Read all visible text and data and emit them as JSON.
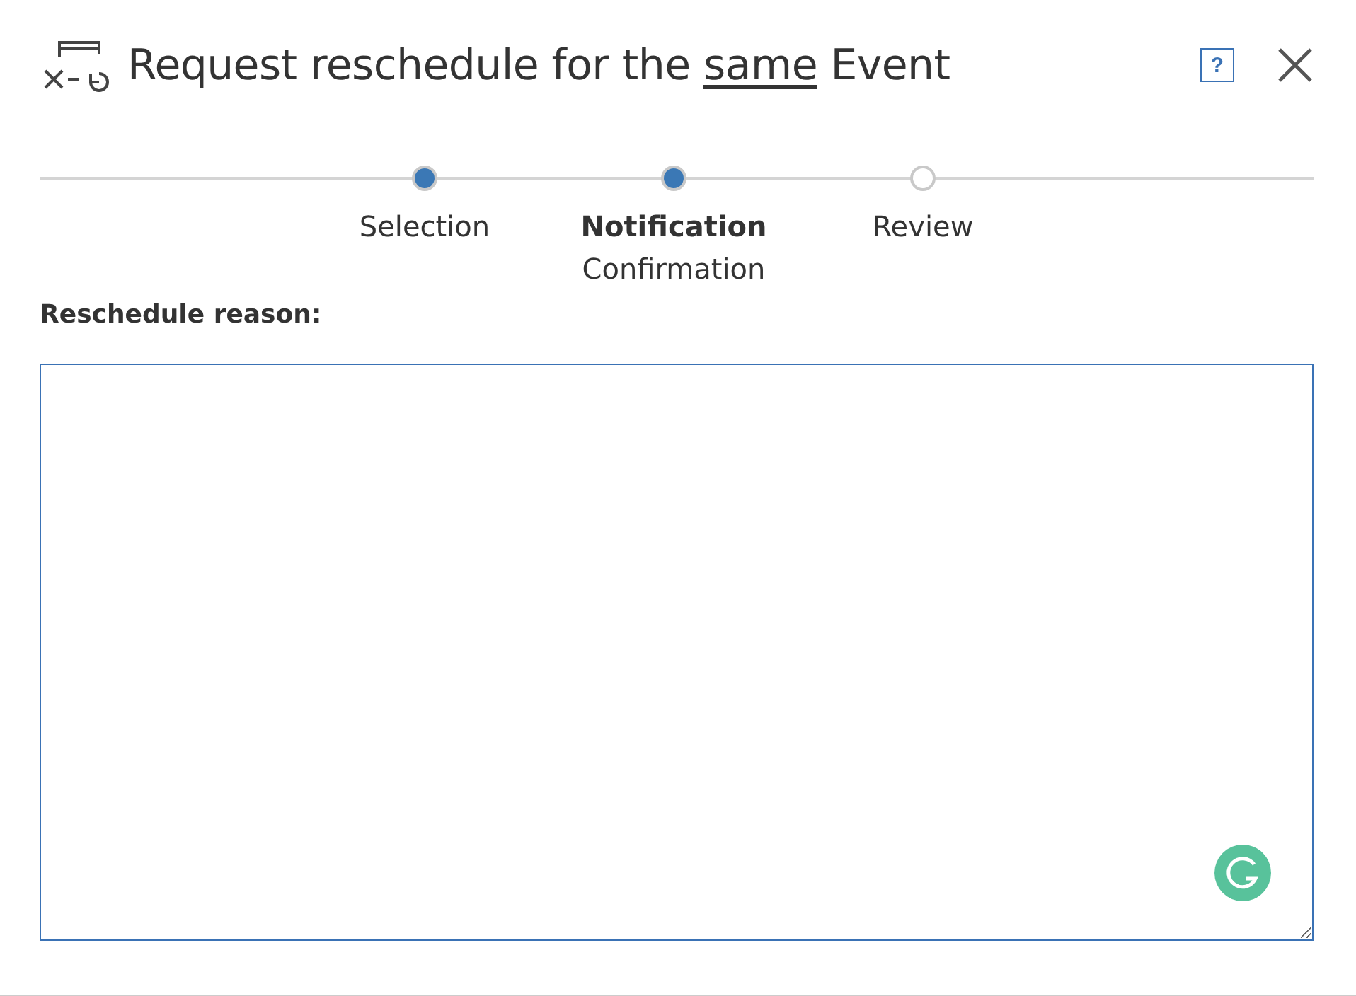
{
  "dialog": {
    "title_start": "Request reschedule for the",
    "title_underlined": "same",
    "title_end": "Event",
    "help": "?"
  },
  "steps": [
    {
      "label": "Selection",
      "completed": true,
      "selected": false
    },
    {
      "label": "Notification",
      "sublabel": "Confirmation",
      "completed": true,
      "selected": true
    },
    {
      "label": "Review",
      "completed": false,
      "selected": false
    }
  ],
  "reason": {
    "label": "Reschedule reason:"
  }
}
